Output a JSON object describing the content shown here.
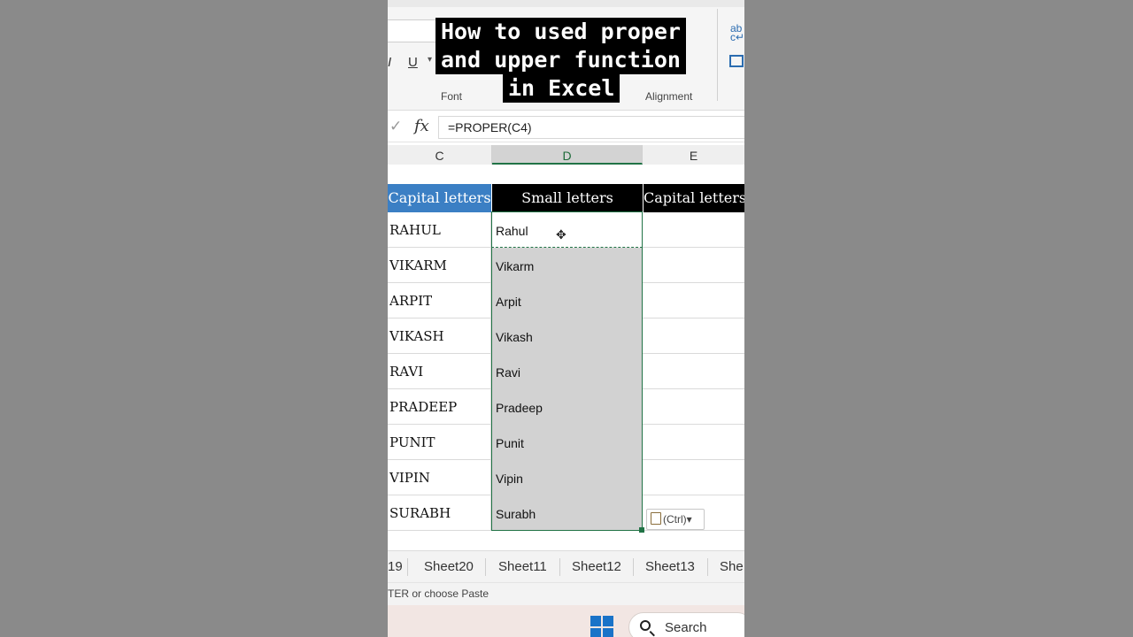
{
  "video_title": {
    "lines": [
      "How to used proper",
      "and upper function",
      "in Excel"
    ]
  },
  "ribbon": {
    "font_group_label": "Font",
    "alignment_group_label": "Alignment",
    "underline_label": "U",
    "italic_label": "I"
  },
  "formula_bar": {
    "fx_label": "fx",
    "formula": "=PROPER(C4)"
  },
  "columns": [
    "C",
    "D",
    "E"
  ],
  "table": {
    "headers": [
      "Capital letters",
      "Small letters",
      "Capital letters"
    ],
    "header_colors": [
      "#3b7fc4",
      "#000000",
      "#000000"
    ],
    "rows": [
      {
        "capital": "RAHUL",
        "proper": "Rahul"
      },
      {
        "capital": "VIKARM",
        "proper": "Vikarm"
      },
      {
        "capital": "ARPIT",
        "proper": "Arpit"
      },
      {
        "capital": "VIKASH",
        "proper": "Vikash"
      },
      {
        "capital": "RAVI",
        "proper": "Ravi"
      },
      {
        "capital": "PRADEEP",
        "proper": "Pradeep"
      },
      {
        "capital": "PUNIT",
        "proper": "Punit"
      },
      {
        "capital": "VIPIN",
        "proper": "Vipin"
      },
      {
        "capital": "SURABH",
        "proper": "Surabh"
      }
    ]
  },
  "paste_options": {
    "label": "(Ctrl)",
    "arrow": "▾",
    "icon": "clipboard-icon"
  },
  "sheet_tabs": [
    "19",
    "Sheet20",
    "Sheet11",
    "Sheet12",
    "Sheet13",
    "She"
  ],
  "status_bar": {
    "text": "TER or choose Paste"
  },
  "taskbar": {
    "search_label": "Search",
    "start_icon": "windows-start-icon"
  },
  "colors": {
    "accent_green": "#217346",
    "selection_fill": "#d2d2d2",
    "header_blue": "#3b7fc4"
  }
}
